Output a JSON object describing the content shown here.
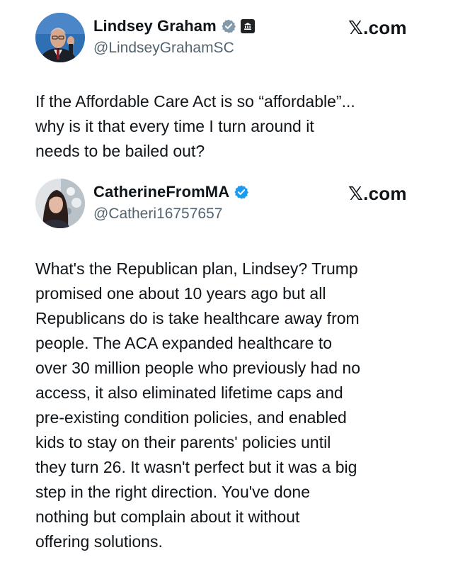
{
  "quoted_post": {
    "author_name": "Lindsey Graham",
    "handle": "@LindseyGrahamSC",
    "site": "𝕏.com",
    "verified_badge_color": "#829aab",
    "avatar_icon": "profile-photo",
    "text_lines": [
      "If the Affordable Care Act is so “affordable”...",
      "why is it that every time I turn around it",
      "needs to be bailed out?"
    ]
  },
  "reply_post": {
    "author_name": "CatherineFromMA",
    "handle": "@Catheri16757657",
    "site": "𝕏.com",
    "verified_badge_color": "#1d9bf0",
    "avatar_icon": "profile-photo",
    "text_lines": [
      "What's the Republican plan, Lindsey? Trump",
      "promised one about 10 years ago but all",
      "Republicans do is take healthcare away from",
      "people. The ACA expanded healthcare to",
      "over 30 million people who previously had no",
      "access, it also eliminated lifetime caps and",
      "pre-existing condition policies, and enabled",
      "kids to stay on their parents' policies until",
      "they turn 26. It wasn't perfect but it was a big",
      "step in the right direction. You've done",
      "nothing but complain about it without",
      "offering solutions."
    ]
  }
}
